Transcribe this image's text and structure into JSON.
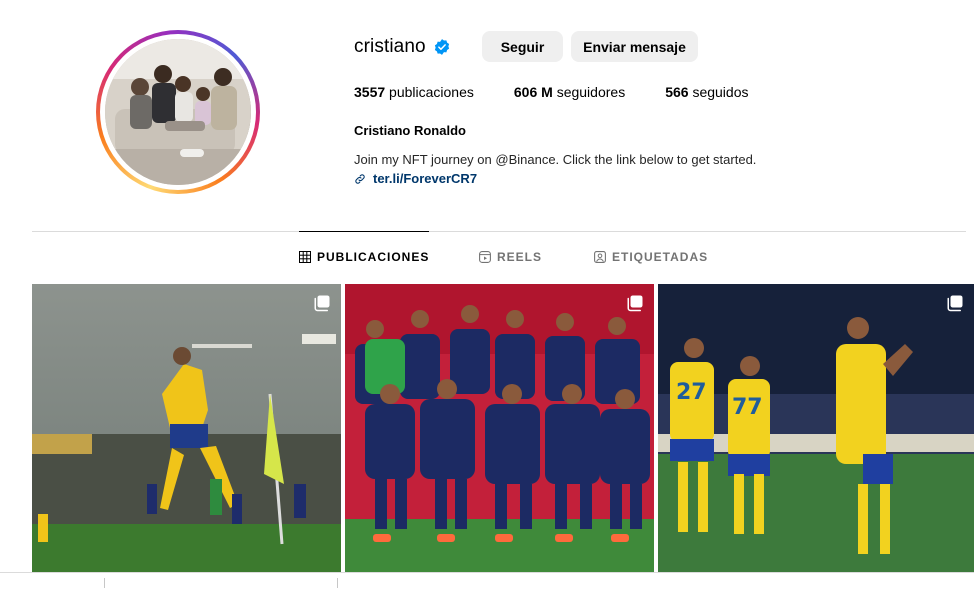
{
  "profile": {
    "username": "cristiano",
    "verified": true,
    "follow_label": "Seguir",
    "message_label": "Enviar mensaje",
    "stats": {
      "posts_count": "3557",
      "posts_label": "publicaciones",
      "followers_count": "606 M",
      "followers_label": "seguidores",
      "following_count": "566",
      "following_label": "seguidos"
    },
    "full_name": "Cristiano Ronaldo",
    "bio": "Join my NFT journey on @Binance. Click the link below to get started.",
    "link": "ter.li/ForeverCR7"
  },
  "tabs": [
    {
      "label": "PUBLICACIONES",
      "icon": "grid-icon",
      "active": true
    },
    {
      "label": "REELS",
      "icon": "reels-icon",
      "active": false
    },
    {
      "label": "ETIQUETADAS",
      "icon": "tagged-icon",
      "active": false
    }
  ],
  "posts": [
    {
      "icon": "multiple-posts-icon"
    },
    {
      "icon": "multiple-posts-icon"
    },
    {
      "icon": "multiple-posts-icon"
    }
  ],
  "colors": {
    "verified_blue": "#0095f6",
    "button_gray": "#efefef",
    "link_blue": "#00376b",
    "divider": "#dbdbdb"
  }
}
